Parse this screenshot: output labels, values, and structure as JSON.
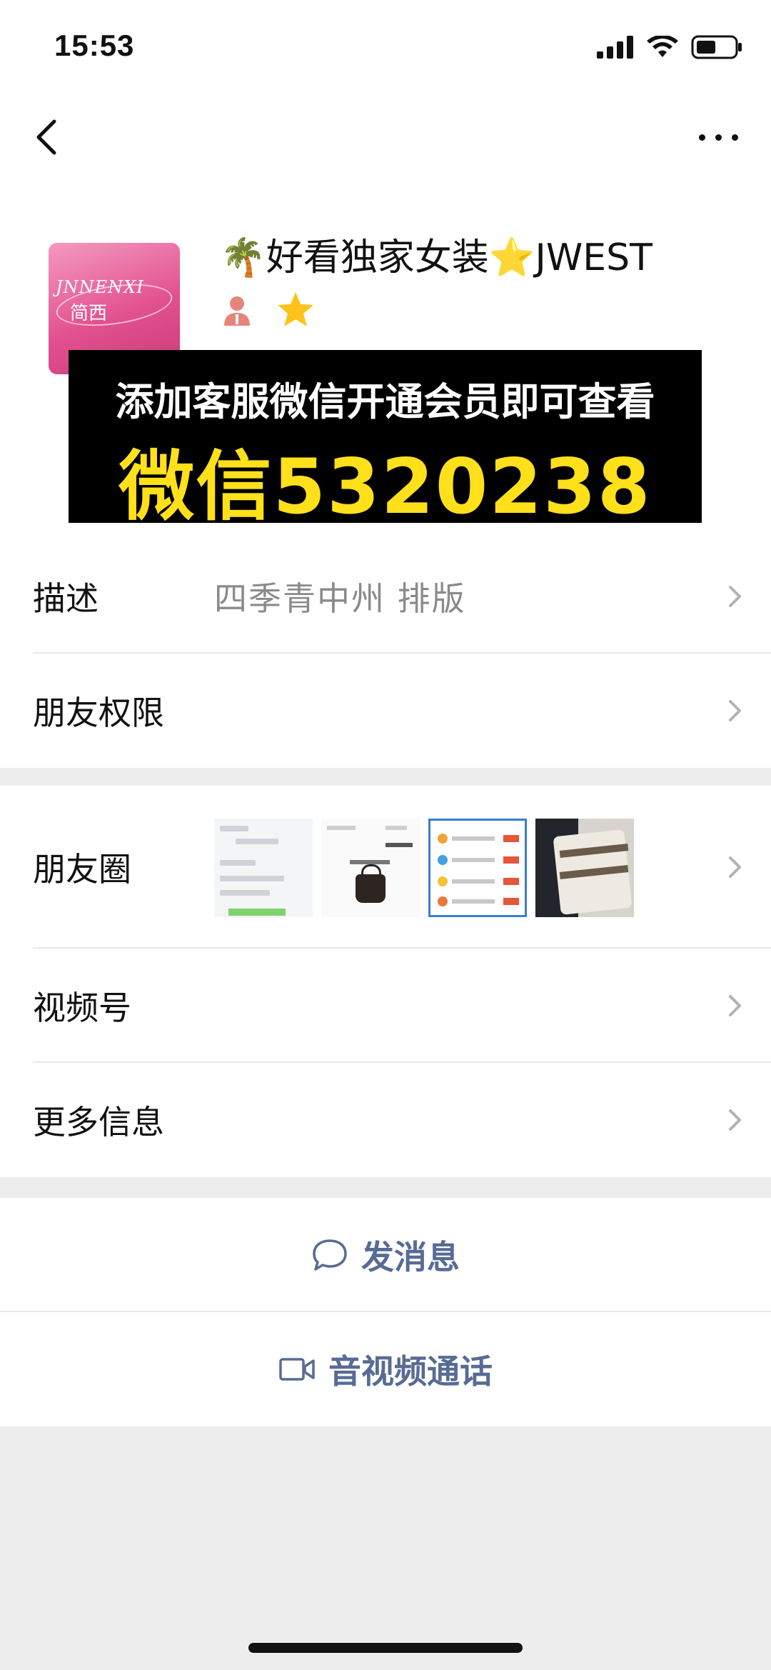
{
  "status": {
    "time": "15:53"
  },
  "contact": {
    "name": "🌴好看独家女装⭐️JWEST"
  },
  "avatar": {
    "brand_en": "JNNENXI",
    "brand_cn": "简西"
  },
  "promo": {
    "line1": "添加客服微信开通会员即可查看",
    "line2": "微信5320238"
  },
  "rows": {
    "description": {
      "label": "描述",
      "value": "四季青中州  排版"
    },
    "friend_permissions": {
      "label": "朋友权限"
    },
    "moments": {
      "label": "朋友圈"
    },
    "channels": {
      "label": "视频号"
    },
    "more_info": {
      "label": "更多信息"
    }
  },
  "actions": {
    "send_message": "发消息",
    "av_call": "音视频通话"
  },
  "colors": {
    "link": "#576b95",
    "promo_yellow": "#ffe01a",
    "avatar_pink": "#e2518f"
  },
  "icons": [
    "back-icon",
    "more-icon",
    "signal-icon",
    "wifi-icon",
    "battery-icon",
    "chevron-right-icon",
    "chat-bubble-icon",
    "video-call-icon",
    "person-icon",
    "star-icon"
  ]
}
